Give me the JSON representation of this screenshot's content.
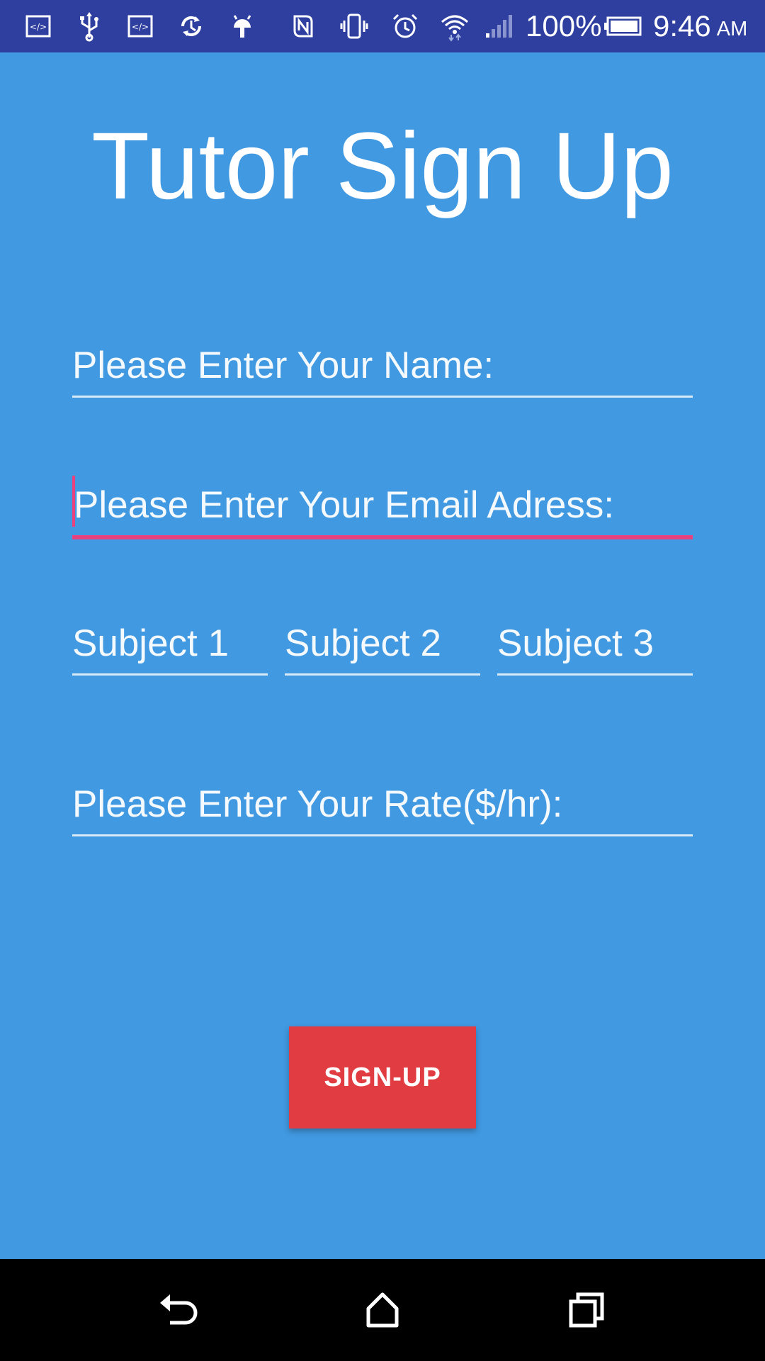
{
  "status_bar": {
    "battery_percent": "100%",
    "time": "9:46",
    "ampm": "AM",
    "icons": [
      "code-icon",
      "usb-icon",
      "code-icon",
      "sync-icon",
      "android-icon",
      "nfc-icon",
      "vibrate-icon",
      "alarm-icon",
      "wifi-icon",
      "signal-icon",
      "battery-icon"
    ]
  },
  "page": {
    "title": "Tutor Sign Up"
  },
  "form": {
    "name_placeholder": "Please Enter Your Name:",
    "email_placeholder": "Please Enter Your Email Adress:",
    "subject1_placeholder": "Subject 1",
    "subject2_placeholder": "Subject 2",
    "subject3_placeholder": "Subject 3",
    "rate_placeholder": "Please Enter Your Rate($/hr):",
    "focused_field": "email"
  },
  "actions": {
    "signup_label": "SIGN-UP"
  },
  "nav": {
    "icons": [
      "back-icon",
      "home-icon",
      "recents-icon"
    ]
  },
  "colors": {
    "background": "#4199e1",
    "status_bar": "#2f3fa0",
    "accent": "#e8427e",
    "button": "#e13c42",
    "nav_bar": "#000000"
  }
}
